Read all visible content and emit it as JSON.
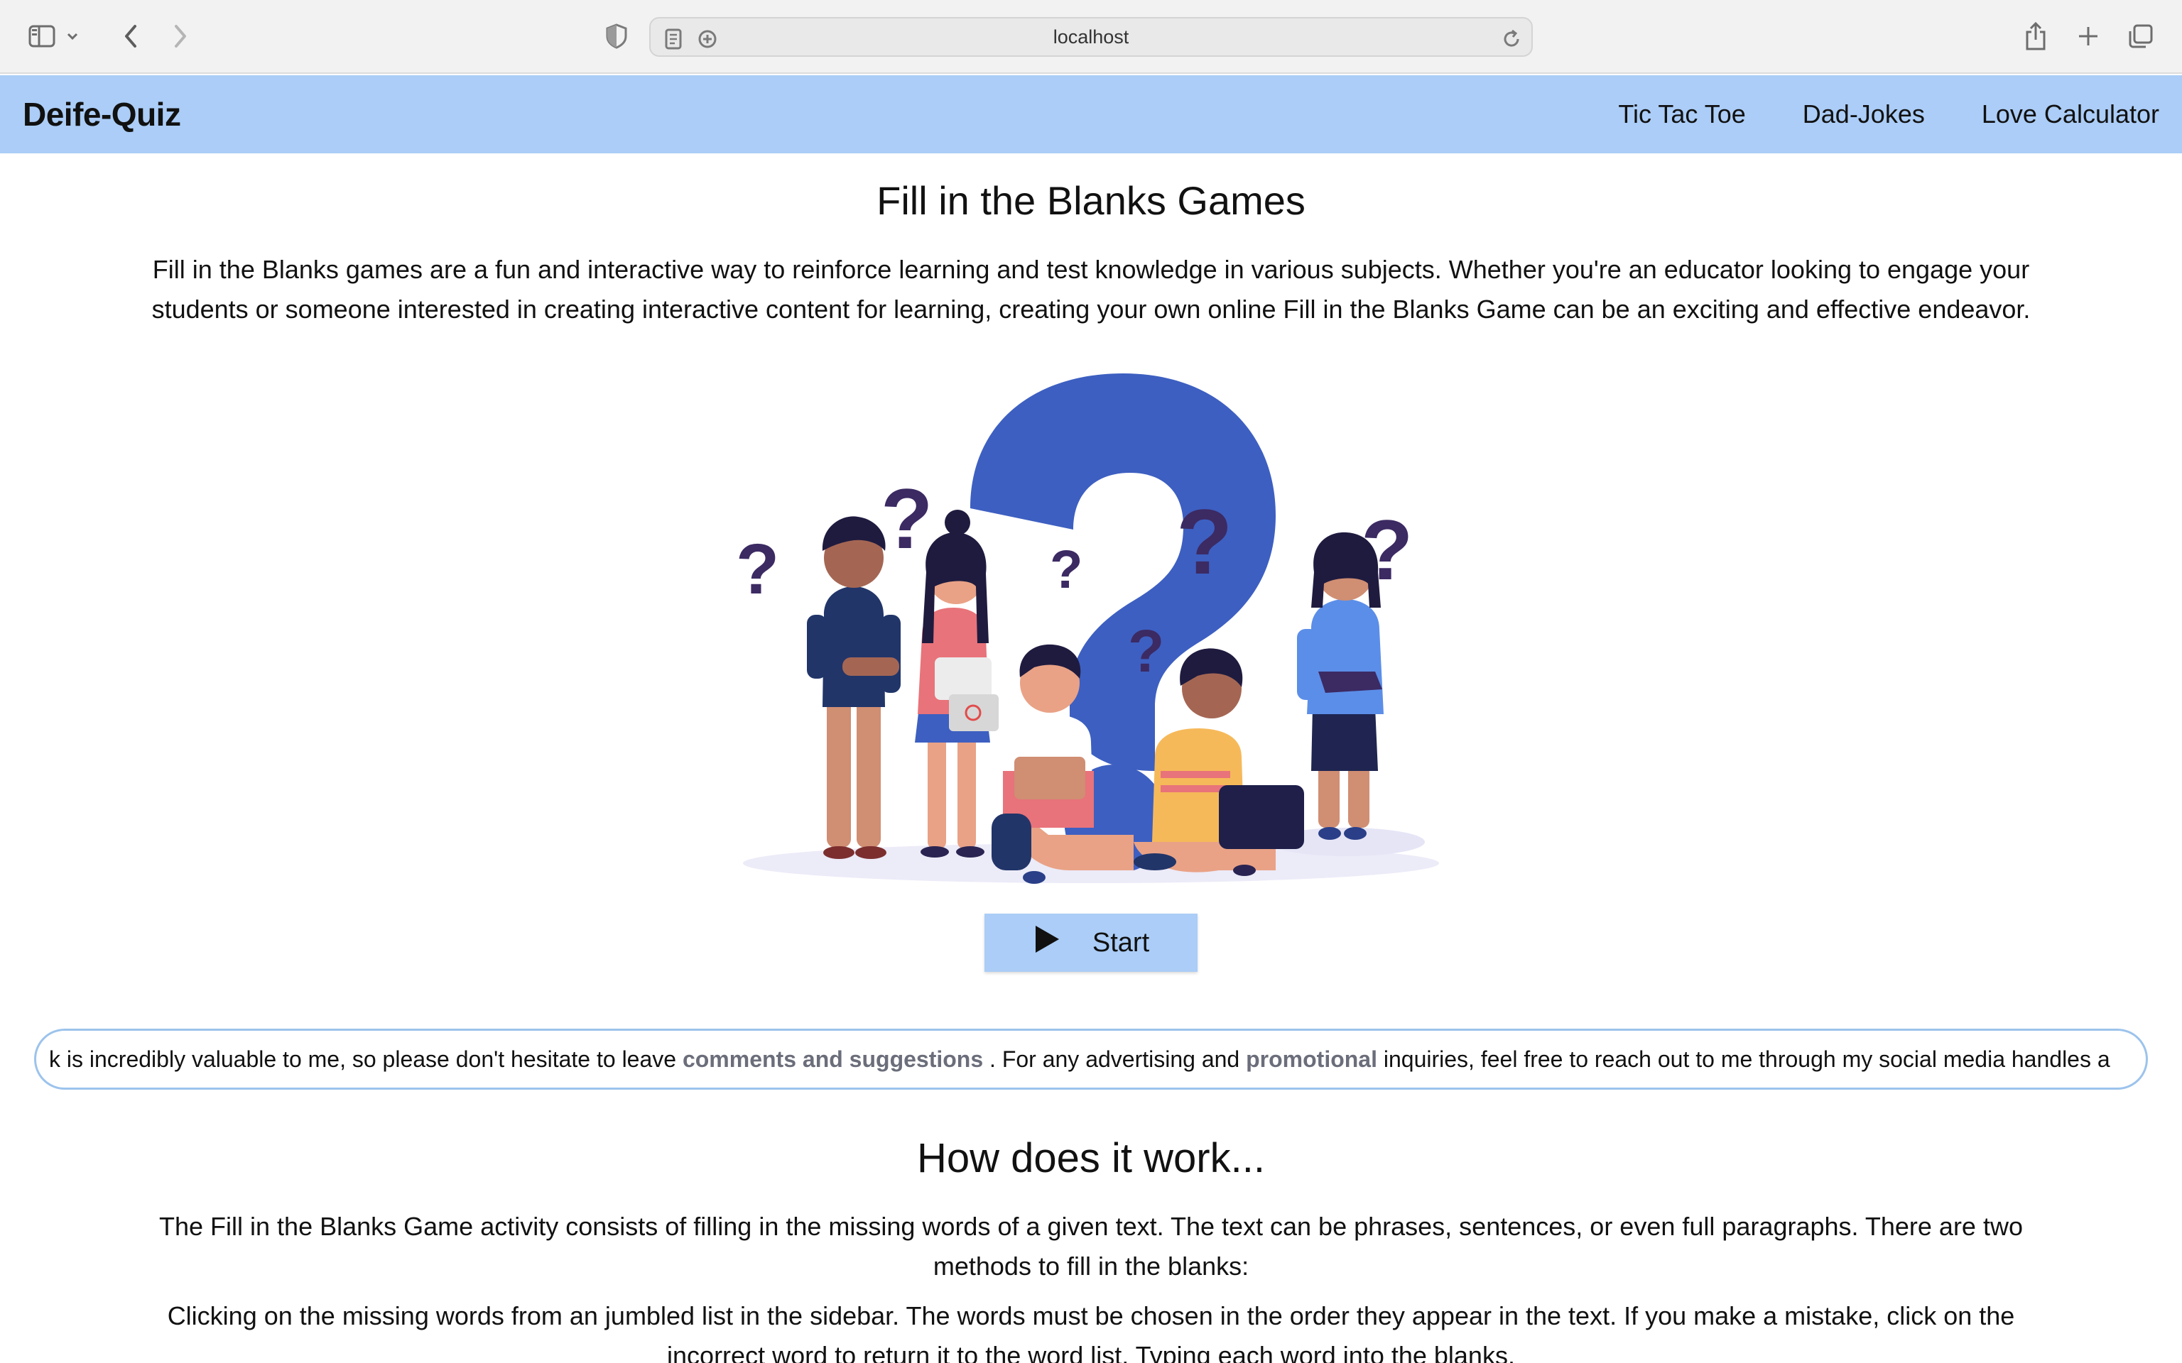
{
  "browser": {
    "url": "localhost",
    "icons": {
      "sidebar": "sidebar-toggle-icon",
      "back": "chevron-left-icon",
      "forward": "chevron-right-icon",
      "privacy": "shield-icon",
      "reader": "reader-icon",
      "site_settings": "site-settings-icon",
      "reload": "reload-icon",
      "share": "share-icon",
      "new_tab": "plus-icon",
      "tabs": "tab-overview-icon"
    }
  },
  "navbar": {
    "brand": "Deife-Quiz",
    "links": [
      "Tic Tac Toe",
      "Dad-Jokes",
      "Love Calculator"
    ],
    "background": "#abcdf7"
  },
  "main": {
    "title": "Fill in the Blanks Games",
    "intro": "Fill in the Blanks games are a fun and interactive way to reinforce learning and test knowledge in various subjects. Whether you're an educator looking to engage your students or someone interested in creating interactive content for learning, creating your own online Fill in the Blanks Game can be an exciting and effective endeavor.",
    "start_label": "Start",
    "start_icon": "play-icon"
  },
  "marquee": {
    "part1": "k is incredibly valuable to me, so please don't hesitate to leave ",
    "highlight1": "comments and suggestions",
    "part2": " . For any advertising and ",
    "highlight2": "promotional",
    "part3": " inquiries, feel free to reach out to me through my social media handles a"
  },
  "how": {
    "title": "How does it work...",
    "p1": "The Fill in the Blanks Game activity consists of filling in the missing words of a given text. The text can be phrases, sentences, or even full paragraphs. There are two methods to fill in the blanks:",
    "p2": "Clicking on the missing words from an jumbled list in the sidebar. The words must be chosen in the order they appear in the text. If you make a mistake, click on the incorrect word to return it to the word list. Typing each word into the blanks."
  },
  "colors": {
    "accent": "#abcdf7",
    "illustration_blue": "#3d5fc1",
    "question_mark_purple": "#3c2a63"
  }
}
